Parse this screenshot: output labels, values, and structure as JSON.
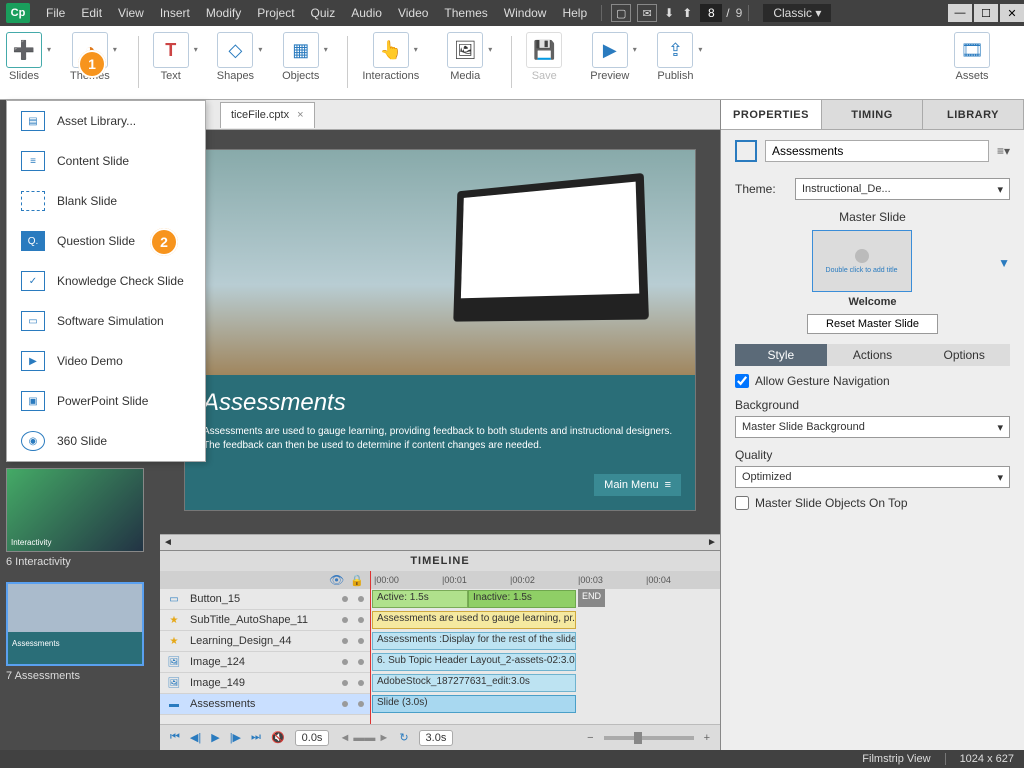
{
  "menu": [
    "File",
    "Edit",
    "View",
    "Insert",
    "Modify",
    "Project",
    "Quiz",
    "Audio",
    "Video",
    "Themes",
    "Window",
    "Help"
  ],
  "page": {
    "current": "8",
    "sep": "/",
    "total": "9"
  },
  "layout_label": "Classic",
  "ribbon": {
    "slides": "Slides",
    "themes": "Themes",
    "text": "Text",
    "shapes": "Shapes",
    "objects": "Objects",
    "interactions": "Interactions",
    "media": "Media",
    "save": "Save",
    "preview": "Preview",
    "publish": "Publish",
    "assets": "Assets"
  },
  "callouts": {
    "step1": "1",
    "step2": "2"
  },
  "slides_menu": [
    "Asset Library...",
    "Content Slide",
    "Blank Slide",
    "Question Slide",
    "Knowledge Check Slide",
    "Software Simulation",
    "Video Demo",
    "PowerPoint Slide",
    "360 Slide"
  ],
  "file_tab": {
    "name": "ticeFile.cptx",
    "close": "×"
  },
  "filmstrip": {
    "item6": "6 Interactivity",
    "item7": "7 Assessments",
    "thumb6_title": "Interactivity",
    "thumb7_title": "Assessments"
  },
  "slide": {
    "title": "Assessments",
    "body": "Assessments are used to gauge learning, providing feedback to both students and instructional designers. The feedback can then be used to determine if content changes are needed.",
    "menu_btn": "Main Menu"
  },
  "timeline": {
    "title": "TIMELINE",
    "ruler": [
      "|00:00",
      "|00:01",
      "|00:02",
      "|00:03",
      "|00:04"
    ],
    "rows": [
      {
        "icon": "btn",
        "name": "Button_15",
        "bar": "Active: 1.5s",
        "bar2": "Inactive: 1.5s",
        "end": "END"
      },
      {
        "icon": "star",
        "name": "SubTitle_AutoShape_11",
        "bar": "Assessments are used to gauge learning, pr..."
      },
      {
        "icon": "star",
        "name": "Learning_Design_44",
        "bar": "Assessments :Display for the rest of the slide"
      },
      {
        "icon": "img",
        "name": "Image_124",
        "bar": "6. Sub Topic Header Layout_2-assets-02:3.0s"
      },
      {
        "icon": "img",
        "name": "Image_149",
        "bar": "AdobeStock_187277631_edit:3.0s"
      },
      {
        "icon": "slide",
        "name": "Assessments",
        "bar": "Slide (3.0s)"
      }
    ],
    "controls": {
      "t_start": "0.0s",
      "t_end": "3.0s"
    }
  },
  "props": {
    "tabs": [
      "PROPERTIES",
      "TIMING",
      "LIBRARY"
    ],
    "title_value": "Assessments",
    "theme_label": "Theme:",
    "theme_value": "Instructional_De...",
    "master_title": "Master Slide",
    "master_hint": "Double click to add title",
    "master_name": "Welcome",
    "reset": "Reset Master Slide",
    "subtabs": [
      "Style",
      "Actions",
      "Options"
    ],
    "gesture": "Allow Gesture Navigation",
    "background_label": "Background",
    "background_value": "Master Slide Background",
    "quality_label": "Quality",
    "quality_value": "Optimized",
    "master_on_top": "Master Slide Objects On Top"
  },
  "footer": {
    "view": "Filmstrip View",
    "dims": "1024 x 627"
  }
}
